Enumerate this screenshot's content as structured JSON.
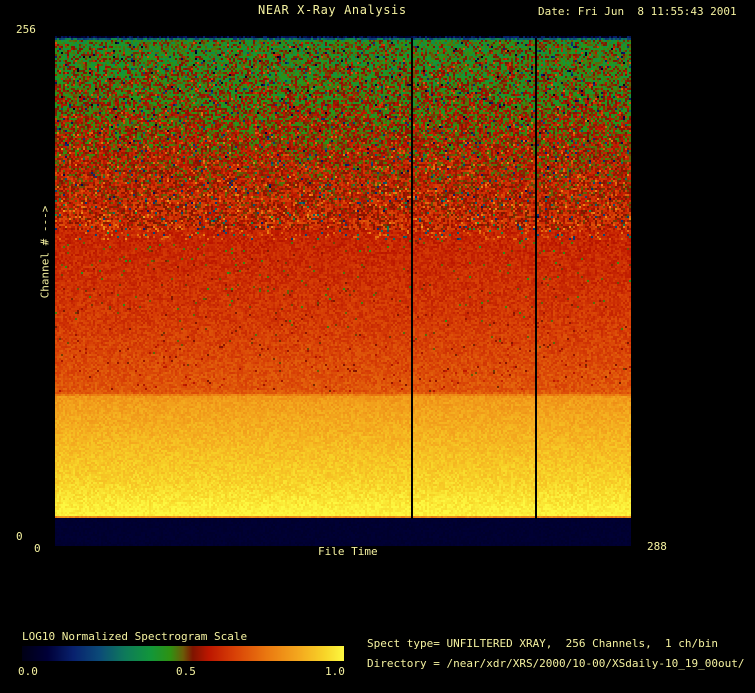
{
  "window": {
    "background": "#000000",
    "text_color": "#f5f2a0"
  },
  "header": {
    "title": "NEAR X-Ray Analysis",
    "date_label": "Date: Fri Jun  8 11:55:43 2001"
  },
  "plot": {
    "y_axis": {
      "label": "Channel # --->",
      "top_tick": "256",
      "bottom_tick": "0"
    },
    "x_axis": {
      "label": "File Time",
      "left_tick": "0",
      "right_tick": "288"
    }
  },
  "colorbar": {
    "title": "LOG10 Normalized Spectrogram Scale",
    "ticks": [
      "0.0",
      "0.5",
      "1.0"
    ]
  },
  "footer": {
    "spect_line": "Spect type= UNFILTERED XRAY,  256 Channels,  1 ch/bin",
    "directory_line": "Directory = /near/xdr/XRS/2000/10-00/XSdaily-10_19_00out/"
  },
  "chart_data": {
    "type": "heatmap",
    "title": "NEAR X-Ray Analysis",
    "xlabel": "File Time",
    "ylabel": "Channel #",
    "xlim": [
      0,
      288
    ],
    "ylim": [
      0,
      256
    ],
    "x_bins": 288,
    "y_bins": 256,
    "scale_label": "LOG10 Normalized Spectrogram Scale",
    "scale_range": [
      0.0,
      1.0
    ],
    "colormap_stops": [
      [
        0.0,
        "#000014"
      ],
      [
        0.08,
        "#000038"
      ],
      [
        0.16,
        "#08216e"
      ],
      [
        0.24,
        "#0b4a78"
      ],
      [
        0.32,
        "#0e7a5a"
      ],
      [
        0.4,
        "#12963a"
      ],
      [
        0.46,
        "#2e9212"
      ],
      [
        0.5,
        "#6a5c08"
      ],
      [
        0.53,
        "#7e1400"
      ],
      [
        0.58,
        "#bc1600"
      ],
      [
        0.66,
        "#d84006"
      ],
      [
        0.76,
        "#ea7810"
      ],
      [
        0.86,
        "#f4a81e"
      ],
      [
        0.94,
        "#f8d428"
      ],
      [
        1.0,
        "#fdf840"
      ]
    ],
    "profile_axes": {
      "x": "channel_fraction_from_bottom",
      "y": "normalized_log10_value"
    },
    "profile": [
      [
        0.0,
        0.065
      ],
      [
        0.052,
        0.065
      ],
      [
        0.056,
        1.0
      ],
      [
        0.12,
        0.94
      ],
      [
        0.2,
        0.89
      ],
      [
        0.292,
        0.83
      ],
      [
        0.3,
        0.7
      ],
      [
        0.45,
        0.645
      ],
      [
        0.62,
        0.605
      ],
      [
        0.75,
        0.555
      ],
      [
        0.88,
        0.49
      ],
      [
        0.97,
        0.455
      ],
      [
        0.993,
        0.45
      ],
      [
        1.0,
        0.08
      ]
    ],
    "noise_regions": [
      {
        "range": [
          0.0,
          0.052
        ],
        "amp": 0.012
      },
      {
        "range": [
          0.052,
          0.295
        ],
        "amp": 0.032
      },
      {
        "range": [
          0.295,
          0.62
        ],
        "amp": 0.038
      },
      {
        "range": [
          0.62,
          1.01
        ],
        "amp": 0.09
      }
    ],
    "speckles": [
      {
        "range": [
          0.6,
          1.0
        ],
        "chance": 0.035,
        "delta": [
          -0.42,
          -0.25
        ]
      },
      {
        "range": [
          0.6,
          1.0
        ],
        "chance": 0.1,
        "delta": [
          0.07,
          0.16
        ]
      },
      {
        "range": [
          0.3,
          0.6
        ],
        "chance": 0.025,
        "delta": [
          -0.16,
          -0.09
        ]
      }
    ],
    "gap_columns_file_time": [
      178,
      240
    ]
  }
}
